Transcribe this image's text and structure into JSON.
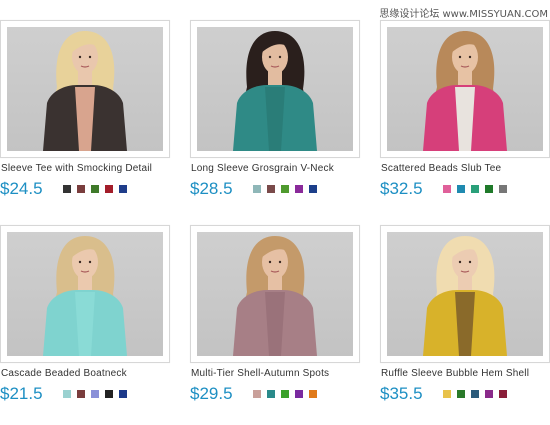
{
  "watermark": "思缘设计论坛 www.MISSYUAN.COM",
  "products": [
    {
      "name": "Sleeve Tee with Smocking Detail",
      "price": "$24.5",
      "garment": "#3a3230",
      "garment2": "#d8a48e",
      "hair": "#e8d29a",
      "skin": "#e9c7ad",
      "swatches": [
        "#333333",
        "#7a3d3d",
        "#3f7a2a",
        "#a31d2a",
        "#1f3d8a"
      ]
    },
    {
      "name": "Long Sleeve Grosgrain V-Neck",
      "price": "$28.5",
      "garment": "#2f8a86",
      "garment2": "#2a7d78",
      "hair": "#2a1f1c",
      "skin": "#e2bca0",
      "swatches": [
        "#8fb7b8",
        "#7a4a4a",
        "#4f9a2e",
        "#8a2a9a",
        "#1c3f8a"
      ]
    },
    {
      "name": "Scattered Beads Slub Tee",
      "price": "$32.5",
      "garment": "#d63f7a",
      "garment2": "#e8e3de",
      "hair": "#b8895a",
      "skin": "#e7c2a4",
      "swatches": [
        "#e0609a",
        "#1f8ab0",
        "#2aa07a",
        "#1f7a2a",
        "#777777"
      ]
    },
    {
      "name": "Cascade Beaded Boatneck",
      "price": "$21.5",
      "garment": "#7fd3cf",
      "garment2": "#8adbd6",
      "hair": "#d9be8c",
      "skin": "#ebc9ae",
      "swatches": [
        "#9ad1d0",
        "#7a3d3d",
        "#8a90d8",
        "#222222",
        "#1c3a8a"
      ]
    },
    {
      "name": "Multi-Tier Shell-Autumn Spots",
      "price": "$29.5",
      "garment": "#a77f86",
      "garment2": "#9a727a",
      "hair": "#c49a6a",
      "skin": "#e6c0a4",
      "swatches": [
        "#c9a09a",
        "#2a8a8a",
        "#3aa02a",
        "#7a2aa0",
        "#e07a1a"
      ]
    },
    {
      "name": "Ruffle Sleeve Bubble Hem Shell",
      "price": "$35.5",
      "garment": "#d8b22a",
      "garment2": "#8a6a2a",
      "hair": "#f0dcb0",
      "skin": "#ecccb2",
      "swatches": [
        "#e8c24a",
        "#2a7a2a",
        "#2a5a7a",
        "#8a2a8a",
        "#8a1f3a"
      ]
    }
  ]
}
